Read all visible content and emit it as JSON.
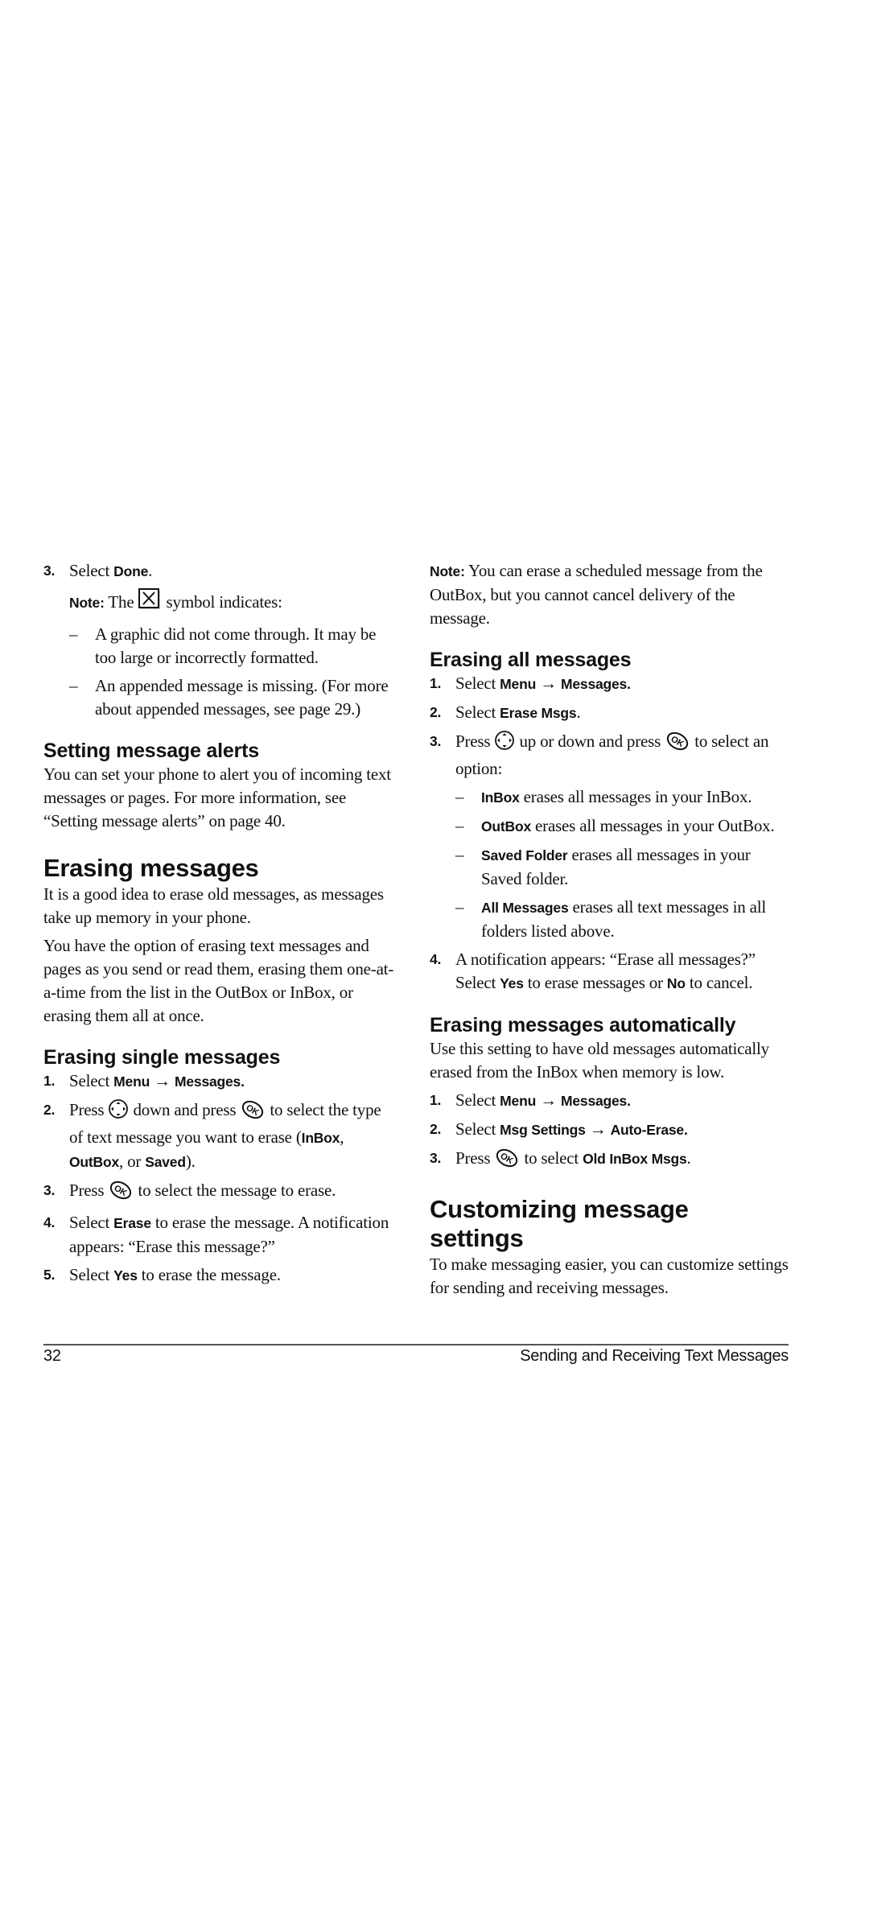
{
  "left": {
    "step3": {
      "num": "3.",
      "pre": "Select ",
      "bold": "Done",
      "post": "."
    },
    "note": {
      "label": "Note:",
      "pre": " The ",
      "icon": "missing-graphic-icon",
      "post": " symbol indicates:",
      "items": [
        "A graphic did not come through. It may be too large or incorrectly formatted.",
        "An appended message is missing. (For more about appended messages, see page 29.)"
      ]
    },
    "alerts": {
      "heading": "Setting message alerts",
      "body": "You can set your phone to alert you of incoming text messages or pages. For more information, see “Setting message alerts” on page 40."
    },
    "erasing": {
      "heading": "Erasing messages",
      "para1": "It is a good idea to erase old messages, as messages take up memory in your phone.",
      "para2": "You have the option of erasing text messages and pages as you send or read them, erasing them one-at-a-time from the list in the OutBox or InBox, or erasing them all at once."
    },
    "single": {
      "heading": "Erasing single messages",
      "steps": [
        {
          "num": "1.",
          "pre": "Select ",
          "b1": "Menu",
          "arrow": "→",
          "b2": "Messages."
        },
        {
          "num": "2.",
          "pre": "Press ",
          "icon1": "navigation-key-icon",
          "mid": " down and press ",
          "icon2": "ok-key-icon",
          "post": " to select the type of text message you want to erase (",
          "b1": "InBox",
          "sep1": ", ",
          "b2": "OutBox",
          "sep2": ", or ",
          "b3": "Saved",
          "end": ")."
        },
        {
          "num": "3.",
          "pre": "Press ",
          "icon": "ok-key-icon",
          "post": " to select the message to erase."
        },
        {
          "num": "4.",
          "pre": "Select ",
          "bold": "Erase",
          "post": " to erase the message. A notification appears: “Erase this message?”"
        },
        {
          "num": "5.",
          "pre": "Select ",
          "bold": "Yes",
          "post": " to erase the message."
        }
      ]
    }
  },
  "right": {
    "note": {
      "label": "Note:",
      "text": " You can erase a scheduled message from the OutBox, but you cannot cancel delivery of the message."
    },
    "all": {
      "heading": "Erasing all messages",
      "steps": [
        {
          "num": "1.",
          "pre": "Select ",
          "b1": "Menu",
          "arrow": "→",
          "b2": "Messages."
        },
        {
          "num": "2.",
          "pre": "Select ",
          "bold": "Erase Msgs",
          "post": "."
        },
        {
          "num": "3.",
          "pre": "Press ",
          "icon1": "navigation-key-icon",
          "mid": " up or down and press ",
          "icon2": "ok-key-icon",
          "post": " to select an option:"
        },
        {
          "num": "4.",
          "pre": "A notification appears: “Erase all messages?” Select ",
          "b1": "Yes",
          "mid": " to erase messages or ",
          "b2": "No",
          "post": " to cancel."
        }
      ],
      "options": [
        {
          "bold": "InBox",
          "text": " erases all messages in your InBox."
        },
        {
          "bold": "OutBox",
          "text": " erases all messages in your OutBox."
        },
        {
          "bold": "Saved Folder",
          "text": " erases all messages in your Saved folder."
        },
        {
          "bold": "All Messages",
          "text": " erases all text messages in all folders listed above."
        }
      ]
    },
    "auto": {
      "heading": "Erasing messages automatically",
      "body": "Use this setting to have old messages automatically erased from the InBox when memory is low.",
      "steps": [
        {
          "num": "1.",
          "pre": "Select ",
          "b1": "Menu",
          "arrow": "→",
          "b2": "Messages."
        },
        {
          "num": "2.",
          "pre": "Select ",
          "b1": "Msg Settings",
          "arrow": "→",
          "b2": "Auto-Erase."
        },
        {
          "num": "3.",
          "pre": "Press ",
          "icon": "ok-key-icon",
          "mid": " to select ",
          "bold": "Old InBox Msgs",
          "post": "."
        }
      ]
    },
    "custom": {
      "heading": "Customizing message settings",
      "body": "To make messaging easier, you can customize settings for sending and receiving messages."
    }
  },
  "footer": {
    "page_number": "32",
    "chapter_title": "Sending and Receiving Text Messages"
  },
  "dash": "–"
}
